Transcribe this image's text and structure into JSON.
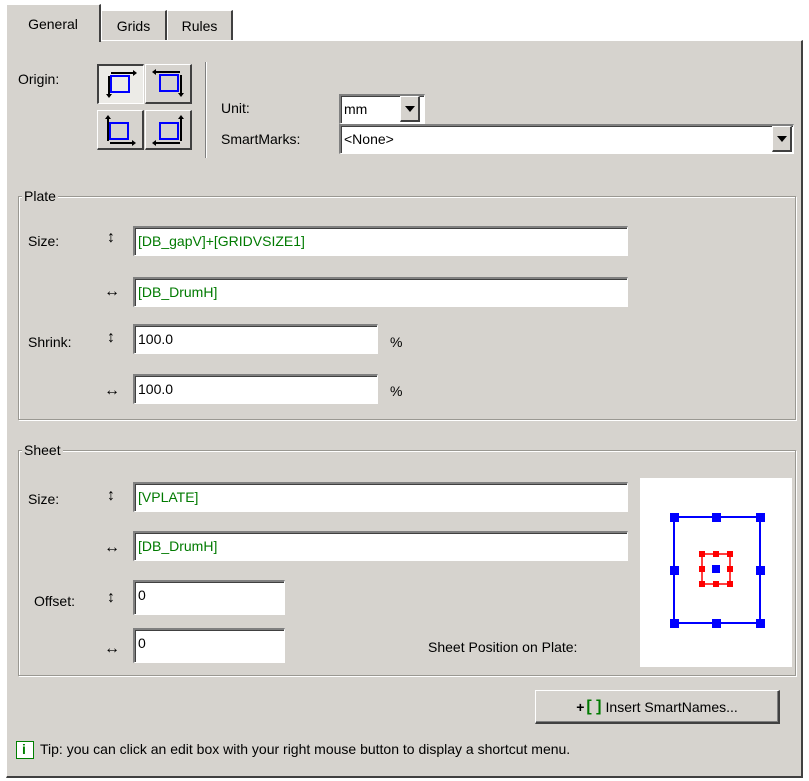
{
  "tabs": [
    {
      "label": "General",
      "active": true
    },
    {
      "label": "Grids",
      "active": false
    },
    {
      "label": "Rules",
      "active": false
    }
  ],
  "origin": {
    "label": "Origin:",
    "selected": "top-left"
  },
  "unit": {
    "label": "Unit:",
    "value": "mm"
  },
  "smartmarks": {
    "label": "SmartMarks:",
    "value": "<None>"
  },
  "plate": {
    "title": "Plate",
    "size_label": "Size:",
    "size_v": "[DB_gapV]+[GRIDVSIZE1]",
    "size_h": "[DB_DrumH]",
    "shrink_label": "Shrink:",
    "shrink_v": "100.0",
    "shrink_h": "100.0",
    "pct": "%"
  },
  "sheet": {
    "title": "Sheet",
    "size_label": "Size:",
    "size_v": "[VPLATE]",
    "size_h": "[DB_DrumH]",
    "offset_label": "Offset:",
    "offset_v": "0",
    "offset_h": "0",
    "position_label": "Sheet Position on Plate:"
  },
  "insert_button": {
    "prefix": "+",
    "bracket": "[ ]",
    "label": "Insert SmartNames..."
  },
  "tip": {
    "text": "Tip: you can click an edit box with your right mouse button to display a shortcut menu."
  },
  "glyphs": {
    "vertical": "↕",
    "horizontal": "↔"
  },
  "colors": {
    "accent_blue": "#0000ff",
    "red": "#ff0000",
    "green_text": "#007a00",
    "face": "#d6d3ce"
  }
}
